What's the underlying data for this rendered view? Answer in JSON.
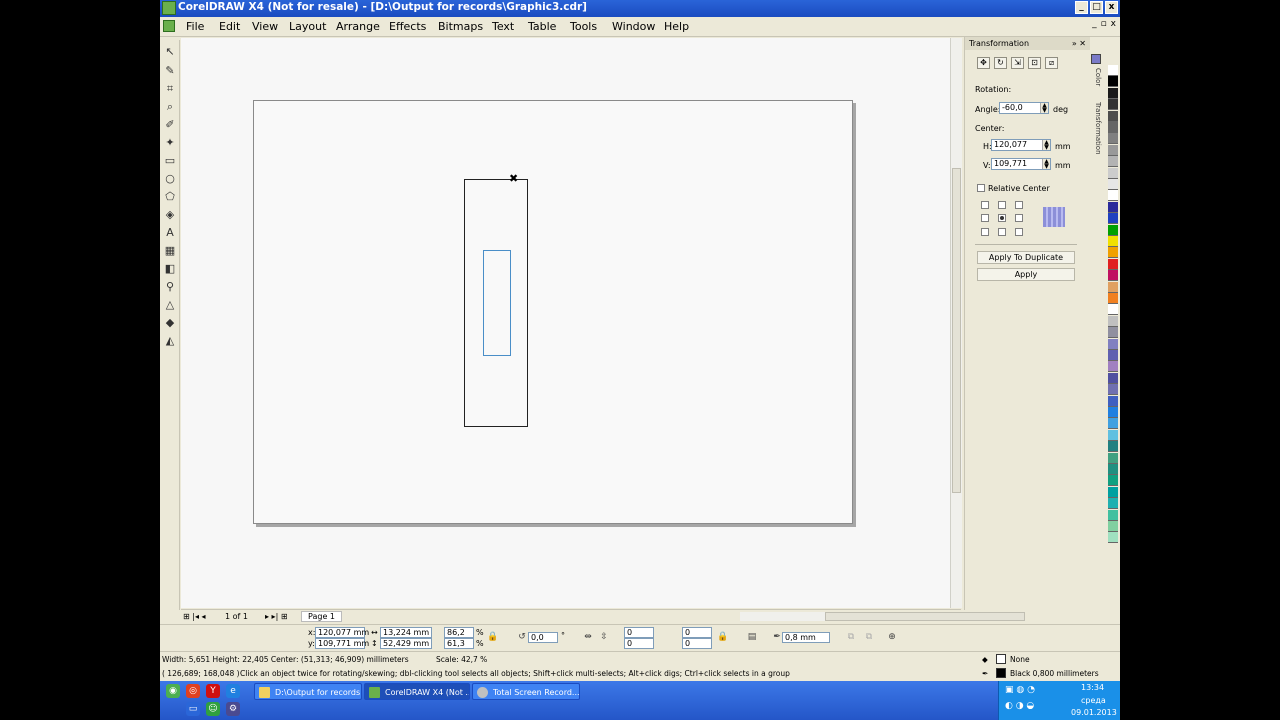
{
  "window": {
    "title": "CorelDRAW X4 (Not for resale) - [D:\\Output for records\\Graphic3.cdr]",
    "buttons": [
      "_",
      "□",
      "x"
    ]
  },
  "menubar": {
    "items": [
      "File",
      "Edit",
      "View",
      "Layout",
      "Arrange",
      "Effects",
      "Bitmaps",
      "Text",
      "Table",
      "Tools",
      "Window",
      "Help"
    ],
    "doc_buttons": [
      "_",
      "▫",
      "x"
    ]
  },
  "toolbox": {
    "tools": [
      "pick-tool",
      "shape-tool",
      "crop-tool",
      "zoom-tool",
      "freehand-tool",
      "smart-fill-tool",
      "rectangle-tool",
      "ellipse-tool",
      "polygon-tool",
      "basic-shapes-tool",
      "text-tool",
      "table-tool",
      "interactive-tool",
      "eyedropper-tool",
      "outline-tool",
      "fill-tool",
      "interactive-fill-tool"
    ]
  },
  "docker": {
    "title": "Transformation",
    "rotation_label": "Rotation:",
    "angle_label": "Angle:",
    "angle_value": "-60,0",
    "angle_unit": "deg",
    "center_label": "Center:",
    "h_label": "H:",
    "h_value": "120,077",
    "h_unit": "mm",
    "v_label": "V:",
    "v_value": "109,771",
    "v_unit": "mm",
    "relative_center_label": "Relative Center",
    "apply_duplicate_label": "Apply To Duplicate",
    "apply_label": "Apply",
    "tabs": [
      "Color",
      "Transformation"
    ]
  },
  "palette": {
    "colors": [
      "#ffffff",
      "#000000",
      "#1a1a1a",
      "#333333",
      "#4d4d4d",
      "#666666",
      "#808080",
      "#999999",
      "#b3b3b3",
      "#cccccc",
      "#e6e6e6",
      "#ffffff",
      "#2a2a9a",
      "#2040c0",
      "#00a000",
      "#f0e000",
      "#f0a000",
      "#e02020",
      "#c01060",
      "#e0a060",
      "#f08020",
      "#ffffff",
      "#c0c0c0",
      "#9090a0",
      "#8080c0",
      "#6060b0",
      "#a080c0",
      "#5050a0",
      "#7070b0",
      "#4060c0",
      "#2080e0",
      "#40a0e0",
      "#60c0e0",
      "#208080",
      "#40a080",
      "#209080",
      "#10a080",
      "#00a0a0",
      "#20b0b0",
      "#40c0a0",
      "#80d0a0",
      "#a0e0c0"
    ]
  },
  "pagebar": {
    "page_count": "1 of 1",
    "page_tab": "Page 1"
  },
  "propbar": {
    "x_label": "x:",
    "x_value": "120,077 mm",
    "y_label": "y:",
    "y_value": "109,771 mm",
    "w_value": "13,224 mm",
    "h_value": "52,429 mm",
    "scale_x": "86,2",
    "scale_y": "61,3",
    "pct": "%",
    "rotation": "0,0",
    "deg": "°",
    "nudge1": "0",
    "nudge2": "0",
    "nudge3": "0",
    "nudge4": "0",
    "outline_width": "0,8 mm"
  },
  "status": {
    "line1": "Width: 5,651  Height: 22,405  Center: (51,313; 46,909)  millimeters",
    "scale": "Scale: 42,7 %",
    "line2_coords": "( 126,689; 168,048 )",
    "line2_hint": "Click an object twice for rotating/skewing; dbl-clicking tool selects all objects; Shift+click multi-selects; Alt+click digs; Ctrl+click selects in a group",
    "fill": "None",
    "outline": "Black  0,800 millimeters"
  },
  "taskbar": {
    "tasks": [
      "D:\\Output for records",
      "CorelDRAW X4 (Not ...",
      "Total Screen Record..."
    ],
    "time": "13:34",
    "day": "среда",
    "date": "09.01.2013"
  }
}
